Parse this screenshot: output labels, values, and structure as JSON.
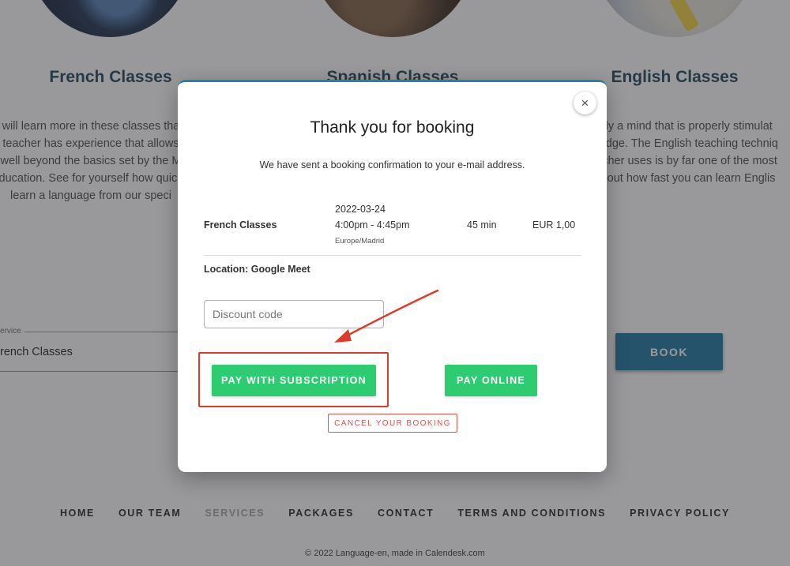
{
  "courses": [
    {
      "title": "French Classes",
      "description": [
        "will learn more in these classes tha",
        "teacher has experience that allows",
        "well beyond the basics set by the M",
        "ducation. See for yourself how quick",
        "learn a language from our speci"
      ]
    },
    {
      "title": "Spanish Classes"
    },
    {
      "title": "English Classes",
      "description": [
        "ckly a mind that is properly stimulat",
        "wledge. The English teaching techniq",
        "eacher uses is by far one of the most",
        "nd out how fast you can learn Englis"
      ]
    }
  ],
  "service_field": {
    "label": "ervice",
    "value": "rench Classes"
  },
  "book_button": "BOOK",
  "footer": {
    "nav": [
      "HOME",
      "OUR TEAM",
      "SERVICES",
      "PACKAGES",
      "CONTACT",
      "TERMS AND CONDITIONS",
      "PRIVACY POLICY"
    ],
    "active": "SERVICES",
    "copyright": "© 2022 Language-en, made in Calendesk.com"
  },
  "modal": {
    "close_symbol": "×",
    "title": "Thank you for booking",
    "subtitle": "We have sent a booking confirmation to your e-mail address.",
    "booking": {
      "service": "French Classes",
      "date": "2022-03-24",
      "time": "4:00pm - 4:45pm",
      "timezone": "Europe/Madrid",
      "duration": "45 min",
      "price": "EUR 1,00"
    },
    "location": "Location: Google Meet",
    "discount_placeholder": "Discount code",
    "pay_subscription": "PAY WITH SUBSCRIPTION",
    "pay_online": "PAY ONLINE",
    "cancel": "CANCEL YOUR BOOKING"
  },
  "colors": {
    "accent": "#2c7ea6",
    "pay_green": "#2ecc71",
    "annotation_red": "#e03a2a",
    "cancel_red": "#d9534f"
  }
}
